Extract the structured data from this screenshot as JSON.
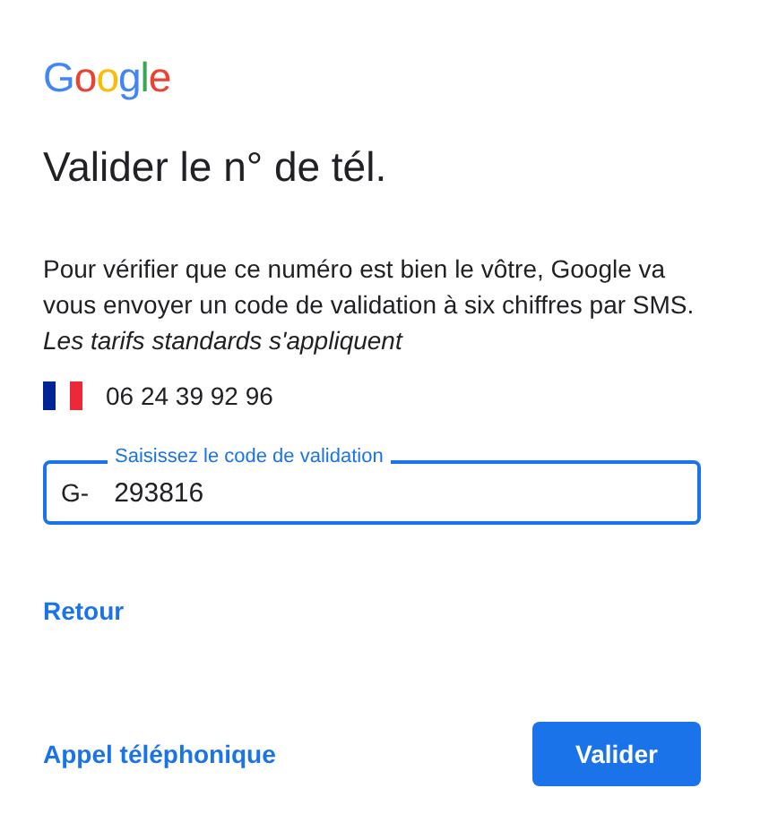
{
  "logo": [
    {
      "text": "G",
      "color": "#4285f4"
    },
    {
      "text": "o",
      "color": "#ea4335"
    },
    {
      "text": "o",
      "color": "#fbbc05"
    },
    {
      "text": "g",
      "color": "#4285f4"
    },
    {
      "text": "l",
      "color": "#34a853"
    },
    {
      "text": "e",
      "color": "#ea4335"
    }
  ],
  "title": "Valider le n° de tél.",
  "description": "Pour vérifier que ce numéro est bien le vôtre, Google va vous envoyer un code de validation à six chiffres par SMS.",
  "note": "Les tarifs standards s'appliquent",
  "phone": {
    "number": "06 24 39 92 96"
  },
  "code_field": {
    "label": "Saisissez le code de validation",
    "prefix": "G-",
    "value": "293816",
    "focused": true
  },
  "back_link": "Retour",
  "call_link": "Appel téléphonique",
  "submit_button": "Valider"
}
